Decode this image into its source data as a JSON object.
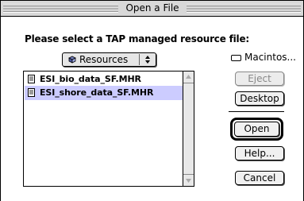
{
  "window": {
    "title": "Open a File"
  },
  "prompt": "Please select a TAP managed resource file:",
  "folder_popup": {
    "selected": "Resources"
  },
  "files": [
    {
      "name": "ESI_bio_data_SF.MHR",
      "selected": false
    },
    {
      "name": "ESI_shore_data_SF.MHR",
      "selected": true
    }
  ],
  "volume": {
    "label": "Macintos..."
  },
  "buttons": {
    "eject": "Eject",
    "desktop": "Desktop",
    "open": "Open",
    "help": "Help...",
    "cancel": "Cancel"
  },
  "colors": {
    "selection": "#ccccff",
    "disabled_text": "#888888"
  }
}
